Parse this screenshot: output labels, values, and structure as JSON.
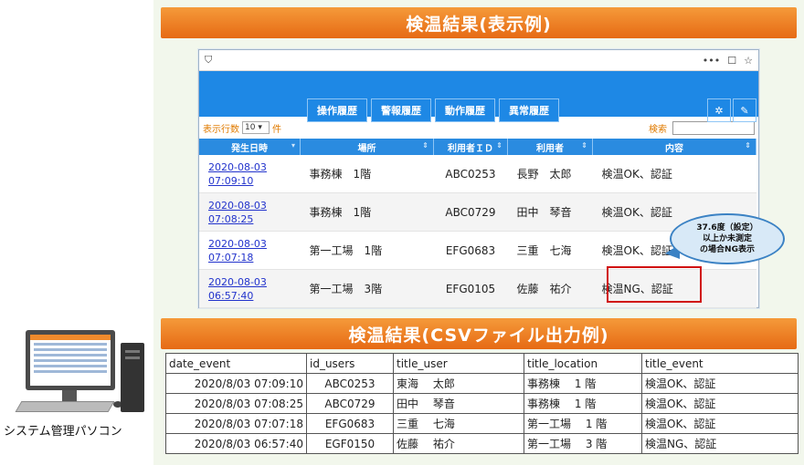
{
  "banner_top": "検温結果(表示例)",
  "banner_mid": "検温結果(CSVファイル出力例)",
  "browser": {
    "addr_icons": [
      "•••",
      "☐",
      "☆"
    ],
    "nav_buttons": [
      "操作履歴",
      "警報履歴",
      "動作履歴",
      "異常履歴"
    ],
    "rows_label": "表示行数",
    "rows_value": "10",
    "rows_unit": "件",
    "search_label": "検索",
    "columns": [
      "発生日時",
      "場所",
      "利用者ＩＤ",
      "利用者",
      "内容"
    ],
    "rows": [
      {
        "date": "2020-08-03",
        "time": "07:09:10",
        "place": "事務棟　1階",
        "id": "ABC0253",
        "user": "長野　太郎",
        "content": "検温OK、認証"
      },
      {
        "date": "2020-08-03",
        "time": "07:08:25",
        "place": "事務棟　1階",
        "id": "ABC0729",
        "user": "田中　琴音",
        "content": "検温OK、認証"
      },
      {
        "date": "2020-08-03",
        "time": "07:07:18",
        "place": "第一工場　1階",
        "id": "EFG0683",
        "user": "三重　七海",
        "content": "検温OK、認証"
      },
      {
        "date": "2020-08-03",
        "time": "06:57:40",
        "place": "第一工場　3階",
        "id": "EFG0105",
        "user": "佐藤　祐介",
        "content": "検温NG、認証"
      }
    ]
  },
  "callout": {
    "line1": "37.6度（設定）",
    "line2": "以上か未測定",
    "line3": "の場合NG表示"
  },
  "csv": {
    "headers": [
      "date_event",
      "id_users",
      "title_user",
      "title_location",
      "title_event"
    ],
    "rows": [
      [
        "2020/8/03  07:09:10",
        "ABC0253",
        "東海　 太郎",
        "事務棟　 1 階",
        "検温OK、認証"
      ],
      [
        "2020/8/03  07:08:25",
        "ABC0729",
        "田中　 琴音",
        "事務棟　 1 階",
        "検温OK、認証"
      ],
      [
        "2020/8/03  07:07:18",
        "EFG0683",
        "三重　 七海",
        "第一工場　 1 階",
        "検温OK、認証"
      ],
      [
        "2020/8/03  06:57:40",
        "EGF0150",
        "佐藤　 祐介",
        "第一工場　 3 階",
        "検温NG、認証"
      ]
    ]
  },
  "pc_label": "システム管理パソコン",
  "colors": {
    "banner": "#f0801e",
    "nav": "#1e88e5",
    "ng_border": "#d01010",
    "callout_fill": "#d8e9f7",
    "link": "#2233cc"
  }
}
